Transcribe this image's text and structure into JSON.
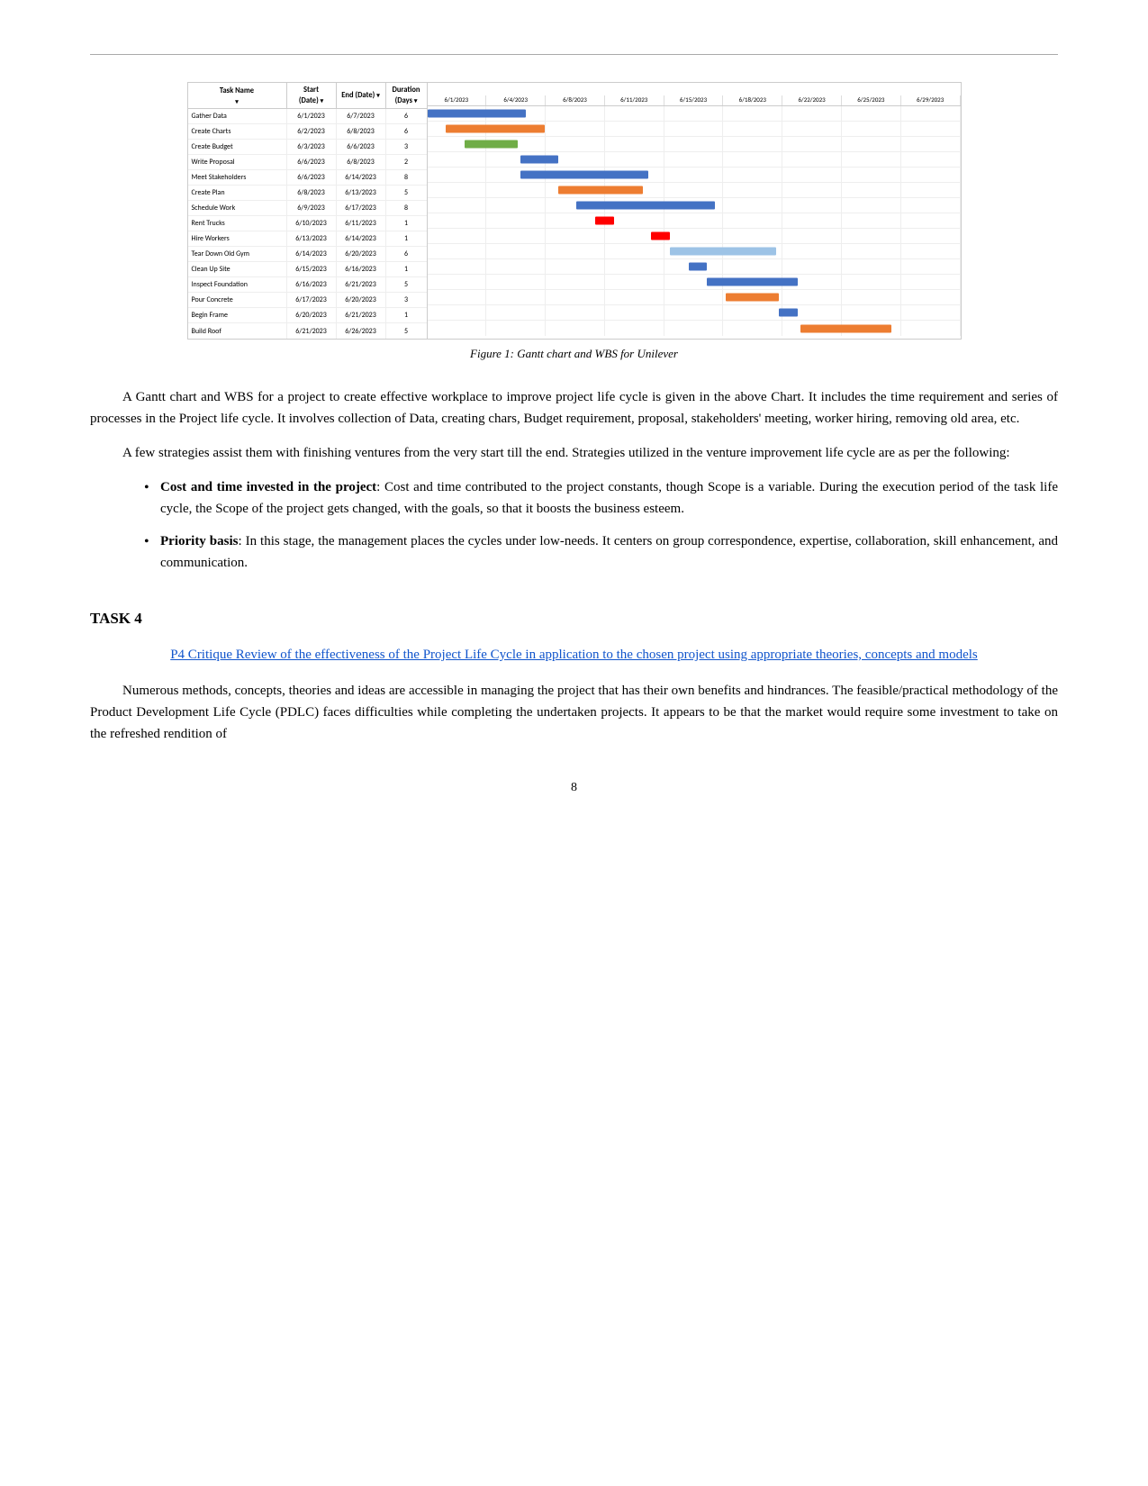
{
  "top_border": true,
  "figure": {
    "caption": "Figure 1: Gantt chart and WBS for Unilever"
  },
  "gantt": {
    "columns": {
      "task_name": "Task Name",
      "start": "Start\n(Date)",
      "end": "End (Date)",
      "duration": "Duration\n(Days)"
    },
    "rows": [
      {
        "task": "Gather Data",
        "start": "6/1/2023",
        "end": "6/7/2023",
        "dur": "6"
      },
      {
        "task": "Create Charts",
        "start": "6/2/2023",
        "end": "6/8/2023",
        "dur": "6"
      },
      {
        "task": "Create Budget",
        "start": "6/3/2023",
        "end": "6/6/2023",
        "dur": "3"
      },
      {
        "task": "Write Proposal",
        "start": "6/6/2023",
        "end": "6/8/2023",
        "dur": "2"
      },
      {
        "task": "Meet Stakeholders",
        "start": "6/6/2023",
        "end": "6/14/2023",
        "dur": "8"
      },
      {
        "task": "Create Plan",
        "start": "6/8/2023",
        "end": "6/13/2023",
        "dur": "5"
      },
      {
        "task": "Schedule Work",
        "start": "6/9/2023",
        "end": "6/17/2023",
        "dur": "8"
      },
      {
        "task": "Rent Trucks",
        "start": "6/10/2023",
        "end": "6/11/2023",
        "dur": "1"
      },
      {
        "task": "Hire Workers",
        "start": "6/13/2023",
        "end": "6/14/2023",
        "dur": "1"
      },
      {
        "task": "Tear Down Old Gym",
        "start": "6/14/2023",
        "end": "6/20/2023",
        "dur": "6"
      },
      {
        "task": "Clean Up Site",
        "start": "6/15/2023",
        "end": "6/16/2023",
        "dur": "1"
      },
      {
        "task": "Inspect Foundation",
        "start": "6/16/2023",
        "end": "6/21/2023",
        "dur": "5"
      },
      {
        "task": "Pour Concrete",
        "start": "6/17/2023",
        "end": "6/20/2023",
        "dur": "3"
      },
      {
        "task": "Begin Frame",
        "start": "6/20/2023",
        "end": "6/21/2023",
        "dur": "1"
      },
      {
        "task": "Build Roof",
        "start": "6/21/2023",
        "end": "6/26/2023",
        "dur": "5"
      }
    ],
    "chart_labels": [
      "6/1/2023",
      "6/4/2023",
      "6/8/2023",
      "6/11/2023",
      "6/15/2023",
      "6/18/2023",
      "6/22/2023",
      "6/25/2023",
      "6/29/2023"
    ],
    "chart_rows": [
      {
        "label": "Gather Data",
        "left_pct": 0,
        "width_pct": 18.5,
        "color": "bar-blue"
      },
      {
        "label": "Create Charts",
        "left_pct": 3.5,
        "width_pct": 18.5,
        "color": "bar-orange"
      },
      {
        "label": "Create Budget",
        "left_pct": 7,
        "width_pct": 10,
        "color": "bar-green"
      },
      {
        "label": "Write Proposal",
        "left_pct": 17.5,
        "width_pct": 7,
        "color": "bar-blue"
      },
      {
        "label": "Meet Stakeholders",
        "left_pct": 17.5,
        "width_pct": 24,
        "color": "bar-blue"
      },
      {
        "label": "Create Plan",
        "left_pct": 24.5,
        "width_pct": 16,
        "color": "bar-orange"
      },
      {
        "label": "Schedule Work",
        "left_pct": 28,
        "width_pct": 26,
        "color": "bar-blue"
      },
      {
        "label": "Rent Trucks",
        "left_pct": 31.5,
        "width_pct": 3.5,
        "color": "bar-red"
      },
      {
        "label": "Hire Workers",
        "left_pct": 42,
        "width_pct": 3.5,
        "color": "bar-red"
      },
      {
        "label": "Tear Down Old Gym",
        "left_pct": 45.5,
        "width_pct": 20,
        "color": "bar-lightblue"
      },
      {
        "label": "Clean Up Site",
        "left_pct": 49,
        "width_pct": 3.5,
        "color": "bar-blue"
      },
      {
        "label": "Inspect Foundation",
        "left_pct": 52.5,
        "width_pct": 17,
        "color": "bar-blue"
      },
      {
        "label": "Pour Concrete",
        "left_pct": 56,
        "width_pct": 10,
        "color": "bar-orange"
      },
      {
        "label": "Begin Frame",
        "left_pct": 66,
        "width_pct": 3.5,
        "color": "bar-blue"
      },
      {
        "label": "Build Roof",
        "left_pct": 70,
        "width_pct": 17,
        "color": "bar-orange"
      }
    ]
  },
  "paragraph1": "A Gantt chart and WBS for a project to create effective workplace to improve project life cycle is given in the above Chart. It includes the time requirement and series of processes in the Project life cycle. It involves collection of Data, creating chars, Budget requirement, proposal, stakeholders' meeting, worker hiring, removing old area, etc.",
  "paragraph2": "A few strategies assist them with finishing ventures from the very start till the end. Strategies utilized in the venture improvement life cycle are as per the following:",
  "bullets": [
    {
      "bold_part": "Cost and time invested in the project",
      "rest": ": Cost and time contributed to the project constants, though Scope is a variable. During the execution period of the task life cycle, the Scope of the project gets changed, with the goals, so that it boosts the business esteem."
    },
    {
      "bold_part": "Priority basis",
      "rest": ": In this stage, the management places the cycles under low-needs. It centers on group correspondence, expertise, collaboration, skill enhancement, and communication."
    }
  ],
  "task4": {
    "heading": "TASK 4",
    "subheading": "P4 Critique Review of the effectiveness of the Project Life Cycle in application to the chosen project using appropriate theories, concepts and models",
    "paragraph": "Numerous methods, concepts, theories and ideas are accessible in managing the project that has their own benefits and hindrances. The feasible/practical methodology of the Product Development Life Cycle (PDLC) faces difficulties while completing the undertaken projects. It appears to be that the market would require some investment to take on the refreshed rendition of"
  },
  "page_number": "8"
}
